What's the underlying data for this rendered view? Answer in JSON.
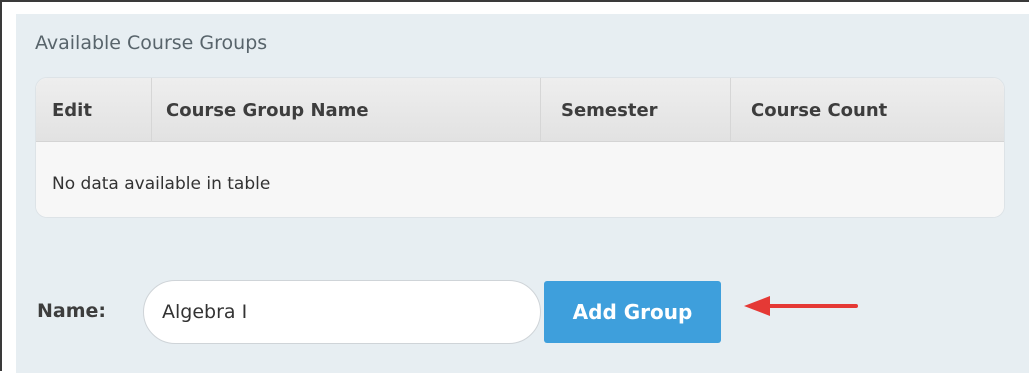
{
  "panel": {
    "title": "Available Course Groups"
  },
  "table": {
    "columns": [
      "Edit",
      "Course Group Name",
      "Semester",
      "Course Count"
    ],
    "empty_message": "No data available in table"
  },
  "form": {
    "name_label": "Name:",
    "name_value": "Algebra I",
    "add_button_label": "Add Group"
  },
  "colors": {
    "panel_bg": "#e7eef2",
    "button_bg": "#3e9fdc",
    "arrow": "#e53935"
  },
  "icons": {
    "callout": "arrow-left-icon"
  }
}
